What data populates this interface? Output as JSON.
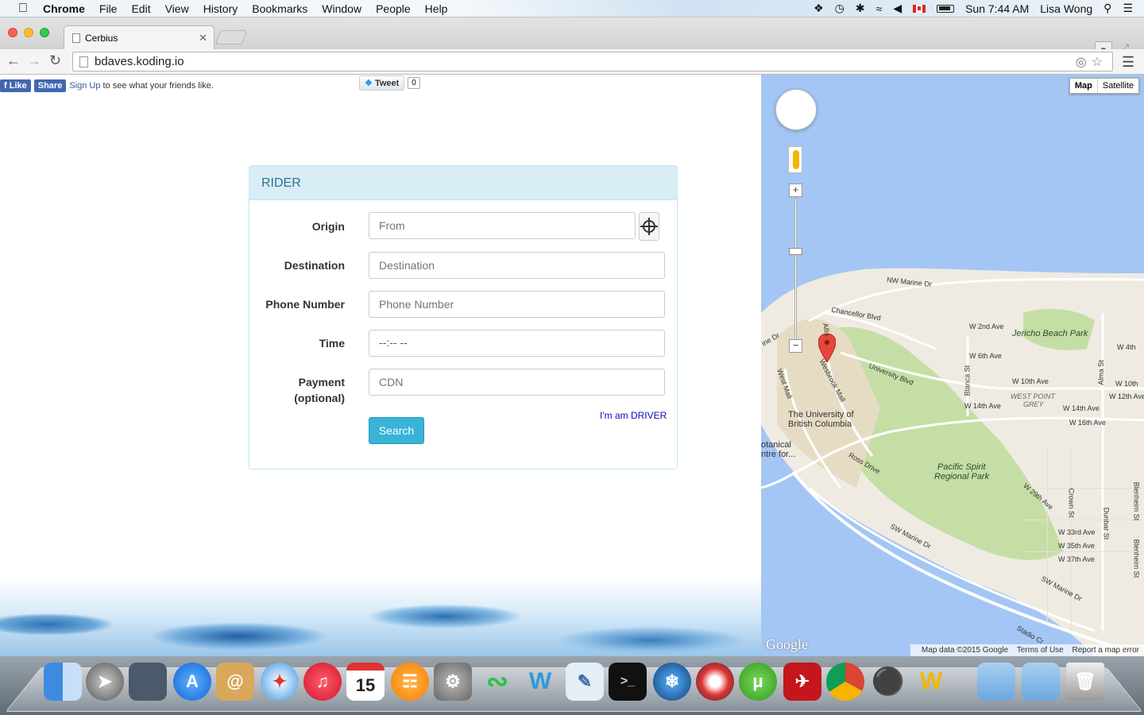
{
  "menubar": {
    "app": "Chrome",
    "menus": [
      "File",
      "Edit",
      "View",
      "History",
      "Bookmarks",
      "Window",
      "People",
      "Help"
    ],
    "clock": "Sun 7:44 AM",
    "user": "Lisa Wong"
  },
  "browser": {
    "tab_title": "Cerbius",
    "url": "bdaves.koding.io"
  },
  "social": {
    "like": "Like",
    "share": "Share",
    "signup": "Sign Up",
    "signup_text": "to see what your friends like.",
    "tweet": "Tweet",
    "tweet_count": "0"
  },
  "form": {
    "title": "RIDER",
    "origin_label": "Origin",
    "origin_placeholder": "From",
    "destination_label": "Destination",
    "destination_placeholder": "Destination",
    "phone_label": "Phone Number",
    "phone_placeholder": "Phone Number",
    "time_label": "Time",
    "time_value": "--:-- --",
    "payment_label_1": "Payment",
    "payment_label_2": "(optional)",
    "payment_placeholder": "CDN",
    "driver_link": "I'm am DRIVER",
    "search_label": "Search"
  },
  "map": {
    "type_map": "Map",
    "type_satellite": "Satellite",
    "labels": {
      "nw_marine": "NW Marine Dr",
      "chancellor": "Chancellor Blvd",
      "w2nd": "W 2nd Ave",
      "jericho": "Jericho Beach Park",
      "w4th": "W 4th",
      "w6th": "W 6th Ave",
      "university": "University Blvd",
      "w10th": "W 10th Ave",
      "w10th_r": "W 10th",
      "w12th": "W 12th Ave",
      "w14th": "W 14th Ave",
      "w14th_r": "W 14th Ave",
      "westpoint1": "WEST POINT",
      "westpoint2": "GREY",
      "w16th": "W 16th Ave",
      "ubc1": "The University of",
      "ubc2": "British Columbia",
      "botanical1": "otanical",
      "botanical2": "ntre for...",
      "ross": "Ross Drive",
      "pacific1": "Pacific Spirit",
      "pacific2": "Regional Park",
      "w29th": "W 29th Ave",
      "w33rd": "W 33rd Ave",
      "w35th": "W 35th Ave",
      "w37th": "W 37th Ave",
      "sw_marine": "SW Marine Dr",
      "sw_marine2": "SW Marine Dr",
      "wesbrook": "Wesbrook Mall",
      "westmall": "West Mall",
      "blanca": "Blanca St",
      "alma": "Alma St",
      "dunbar": "Dunbar St",
      "crown": "Crown St",
      "blenheim": "Blenheim St",
      "blenheim2": "Blenheim St",
      "stadium": "Stadio Cr",
      "ine_dr": "ine Dr",
      "allison": "Allis"
    },
    "google": "Google",
    "footer_data": "Map data ©2015 Google",
    "footer_terms": "Terms of Use",
    "footer_report": "Report a map error"
  },
  "colors": {
    "panel_head_bg": "#d9edf7",
    "panel_head_text": "#31708f",
    "search_btn": "#39b3d7",
    "water": "#a4c6f4",
    "park": "#c5dea5",
    "land": "#efebe2"
  }
}
